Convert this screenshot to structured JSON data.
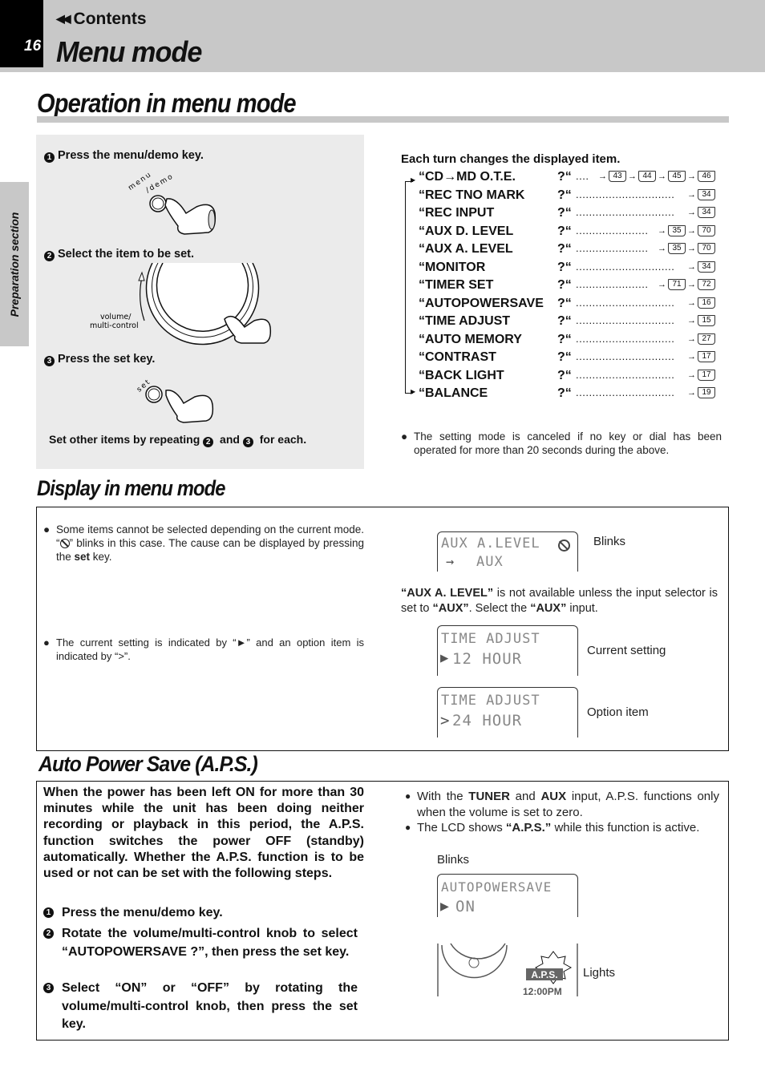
{
  "header": {
    "page_number": "16",
    "contents_link": "Contents",
    "chapter_title": "Menu mode"
  },
  "side_tab": "Preparation section",
  "operation": {
    "title": "Operation in menu mode",
    "steps": [
      {
        "num": "1",
        "label": "Press the menu/demo key.",
        "illus_label": "menu/demo"
      },
      {
        "num": "2",
        "label": "Select the item to be set.",
        "illus_label": "volume/ multi-control"
      },
      {
        "num": "3",
        "label": "Press the set key.",
        "illus_label": "set"
      }
    ],
    "footer_pre": "Set other items by repeating ",
    "footer_num2": "2",
    "footer_mid": " and ",
    "footer_num3": "3",
    "footer_post": " for each.",
    "menu_title": "Each turn changes the displayed item.",
    "menu_items": [
      {
        "name": "“CD→MD O.T.E.",
        "q": "?“",
        "dots": "....",
        "refs": [
          "43",
          "44",
          "45",
          "46"
        ]
      },
      {
        "name": "“REC TNO MARK",
        "q": "?“",
        "dots": "..............................",
        "refs": [
          "34"
        ]
      },
      {
        "name": "“REC INPUT",
        "q": "?“",
        "dots": "..............................",
        "refs": [
          "34"
        ]
      },
      {
        "name": "“AUX D. LEVEL",
        "q": "?“",
        "dots": "......................",
        "refs": [
          "35",
          "70"
        ]
      },
      {
        "name": "“AUX A. LEVEL",
        "q": "?“",
        "dots": "......................",
        "refs": [
          "35",
          "70"
        ]
      },
      {
        "name": "“MONITOR",
        "q": "?“",
        "dots": "..............................",
        "refs": [
          "34"
        ]
      },
      {
        "name": "“TIMER SET",
        "q": "?“",
        "dots": "......................",
        "refs": [
          "71",
          "72"
        ]
      },
      {
        "name": "“AUTOPOWERSAVE",
        "q": "?“",
        "dots": "..............................",
        "refs": [
          "16"
        ]
      },
      {
        "name": "“TIME ADJUST",
        "q": "?“",
        "dots": "..............................",
        "refs": [
          "15"
        ]
      },
      {
        "name": "“AUTO MEMORY",
        "q": "?“",
        "dots": "..............................",
        "refs": [
          "27"
        ]
      },
      {
        "name": "“CONTRAST",
        "q": "?“",
        "dots": "..............................",
        "refs": [
          "17"
        ]
      },
      {
        "name": "“BACK LIGHT",
        "q": "?“",
        "dots": "..............................",
        "refs": [
          "17"
        ]
      },
      {
        "name": "“BALANCE",
        "q": "?“",
        "dots": "..............................",
        "refs": [
          "19"
        ]
      }
    ],
    "cancel_note": "The setting mode is canceled if no key or dial has been operated for more than 20 seconds during the above."
  },
  "display": {
    "title": "Display in menu mode",
    "note1_pre": "Some items cannot be selected depending on the current mode. “",
    "note1_mid": "” blinks in this case. The cause can be displayed by pressing the ",
    "note1_bold": "set",
    "note1_post": " key.",
    "note2": "The current setting is indicated by “►” and an option item is indicated by “>”.",
    "lcd1": {
      "line1": "AUX A.LEVEL",
      "line2": "AUX",
      "caption": "Blinks"
    },
    "aux_note_b1": "“AUX A. LEVEL”",
    "aux_note_t1": " is not available unless the input selector is set to ",
    "aux_note_b2": "“AUX”",
    "aux_note_t2": ". Select the ",
    "aux_note_b3": "“AUX”",
    "aux_note_t3": " input.",
    "lcd2": {
      "line1": "TIME ADJUST",
      "marker": "▶",
      "line2": "12 HOUR",
      "caption": "Current setting"
    },
    "lcd3": {
      "line1": "TIME ADJUST",
      "marker": ">",
      "line2": "24 HOUR",
      "caption": "Option item"
    }
  },
  "aps": {
    "title": "Auto Power Save (A.P.S.)",
    "intro": "When the power has been left ON for more than 30 minutes while the unit has been doing neither recording or playback in this period, the A.P.S. function switches the power OFF (standby) automatically. Whether the A.P.S. function is to be used or not can be set with the following steps.",
    "steps": [
      {
        "num": "1",
        "text": "Press the menu/demo key."
      },
      {
        "num": "2",
        "text": "Rotate the volume/multi-control knob to select “AUTOPOWERSAVE  ?”, then press the set key."
      },
      {
        "num": "3",
        "text": "Select “ON” or “OFF” by rotating the volume/multi-control knob, then press the set key."
      }
    ],
    "note1_pre": "With the ",
    "note1_b1": "TUNER",
    "note1_mid": " and ",
    "note1_b2": "AUX",
    "note1_post": " input, A.P.S. functions only when the volume is set to zero.",
    "note2_pre": "The LCD shows ",
    "note2_b": "“A.P.S.”",
    "note2_post": " while this function is active.",
    "blinks_label": "Blinks",
    "lcd": {
      "line1": "AUTOPOWERSAVE",
      "marker": "▶",
      "line2": "ON"
    },
    "badge": "A.P.S.",
    "clock": "12:00PM",
    "lights_label": "Lights"
  }
}
